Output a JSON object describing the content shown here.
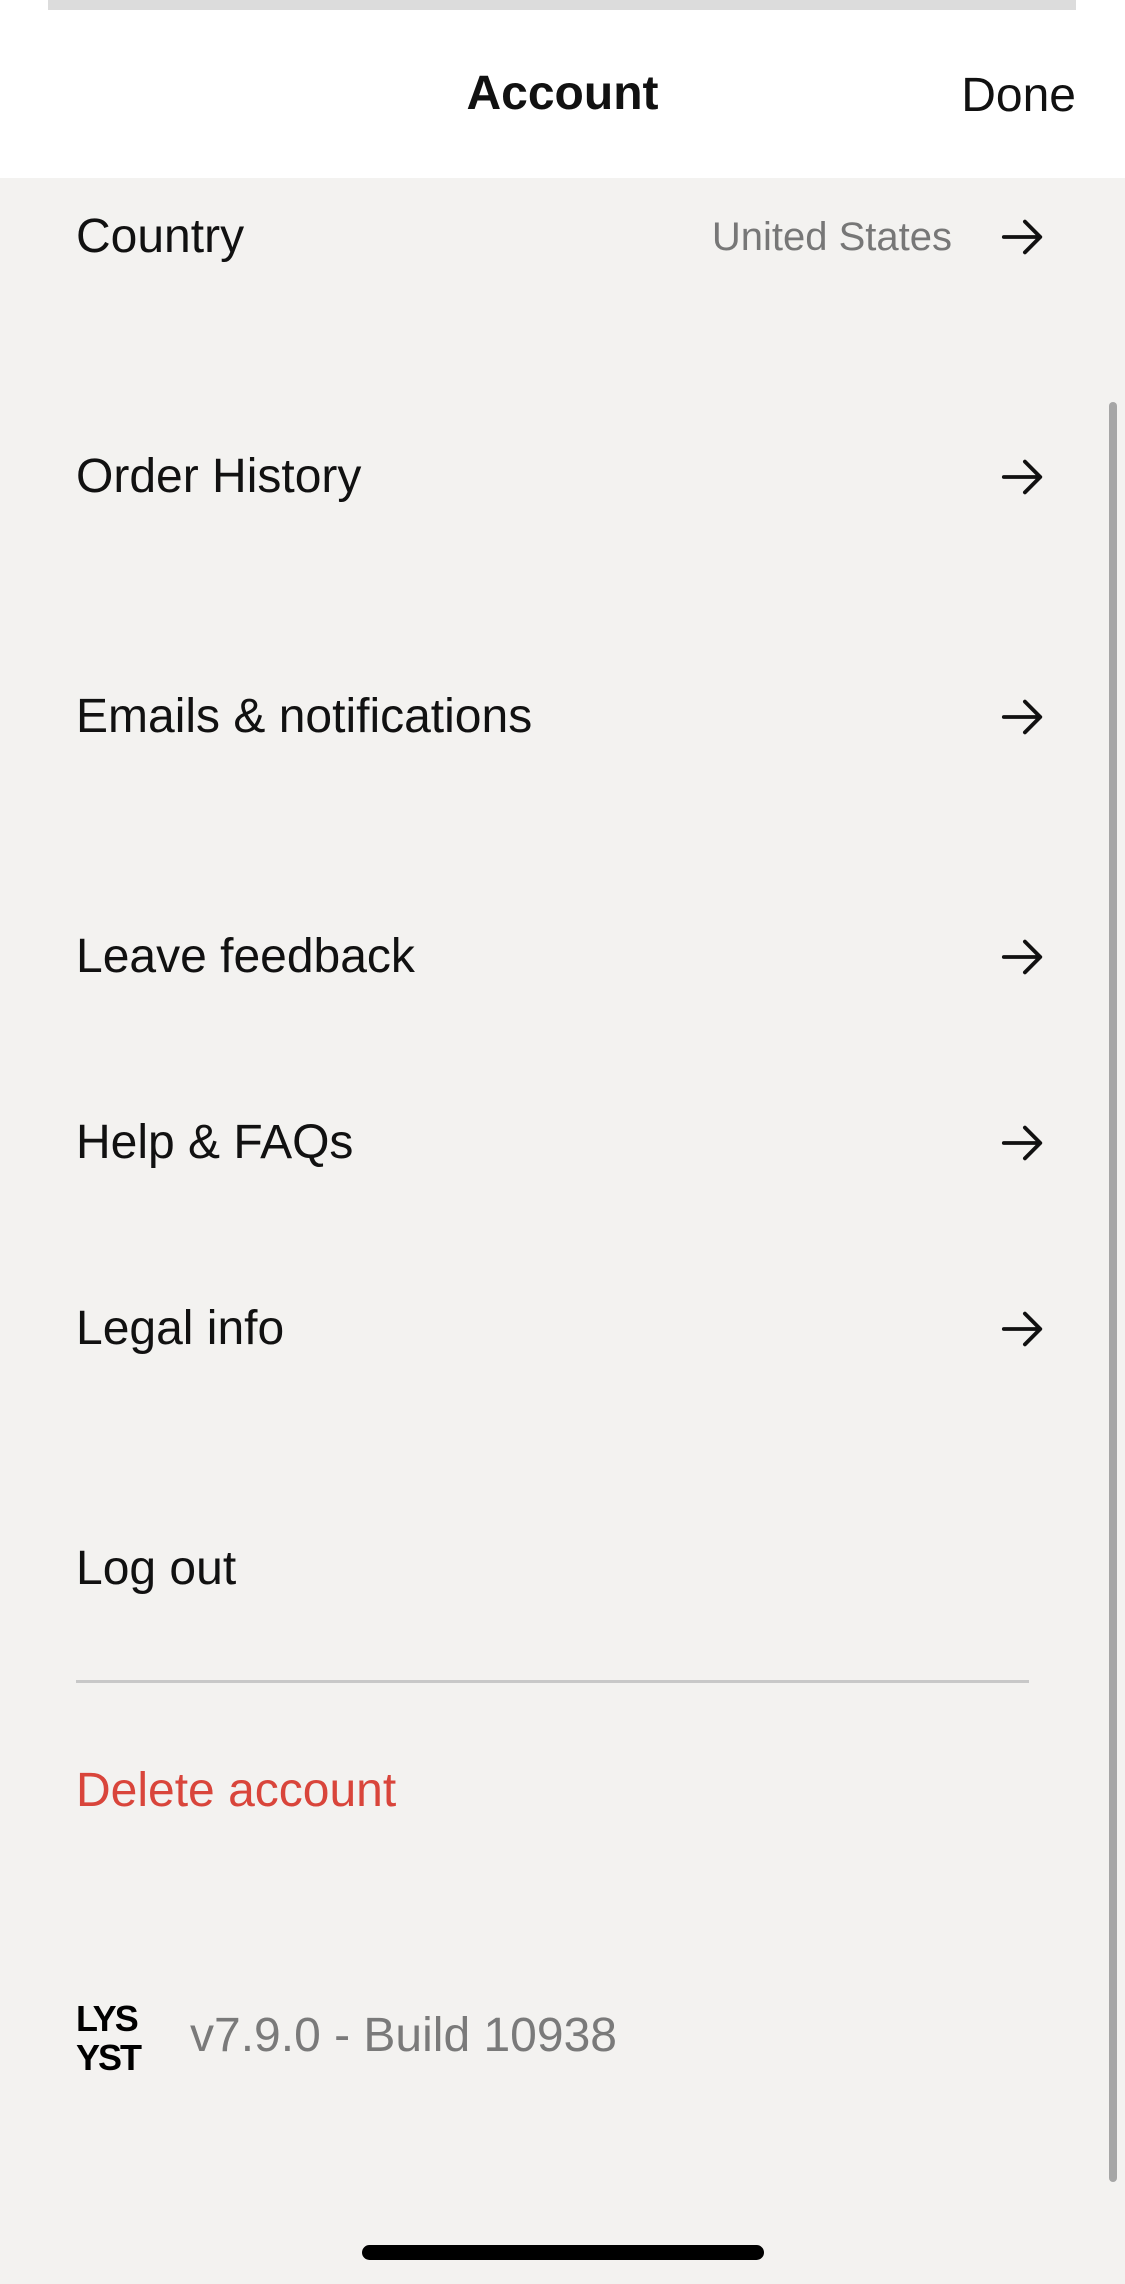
{
  "header": {
    "title": "Account",
    "done_label": "Done"
  },
  "menu": {
    "country": {
      "label": "Country",
      "value": "United States"
    },
    "order_history": {
      "label": "Order History"
    },
    "emails": {
      "label": "Emails & notifications"
    },
    "feedback": {
      "label": "Leave feedback"
    },
    "help": {
      "label": "Help & FAQs"
    },
    "legal": {
      "label": "Legal info"
    },
    "logout": {
      "label": "Log out"
    },
    "delete": {
      "label": "Delete account"
    }
  },
  "footer": {
    "logo_text": "LYST",
    "version": "v7.9.0 - Build 10938"
  },
  "colors": {
    "background": "#f3f2f0",
    "header_background": "#ffffff",
    "text": "#111111",
    "secondary_text": "#777777",
    "danger": "#d9453b"
  },
  "icons": {
    "row_arrow": "arrow-right-icon",
    "brand": "lyst-logo"
  }
}
